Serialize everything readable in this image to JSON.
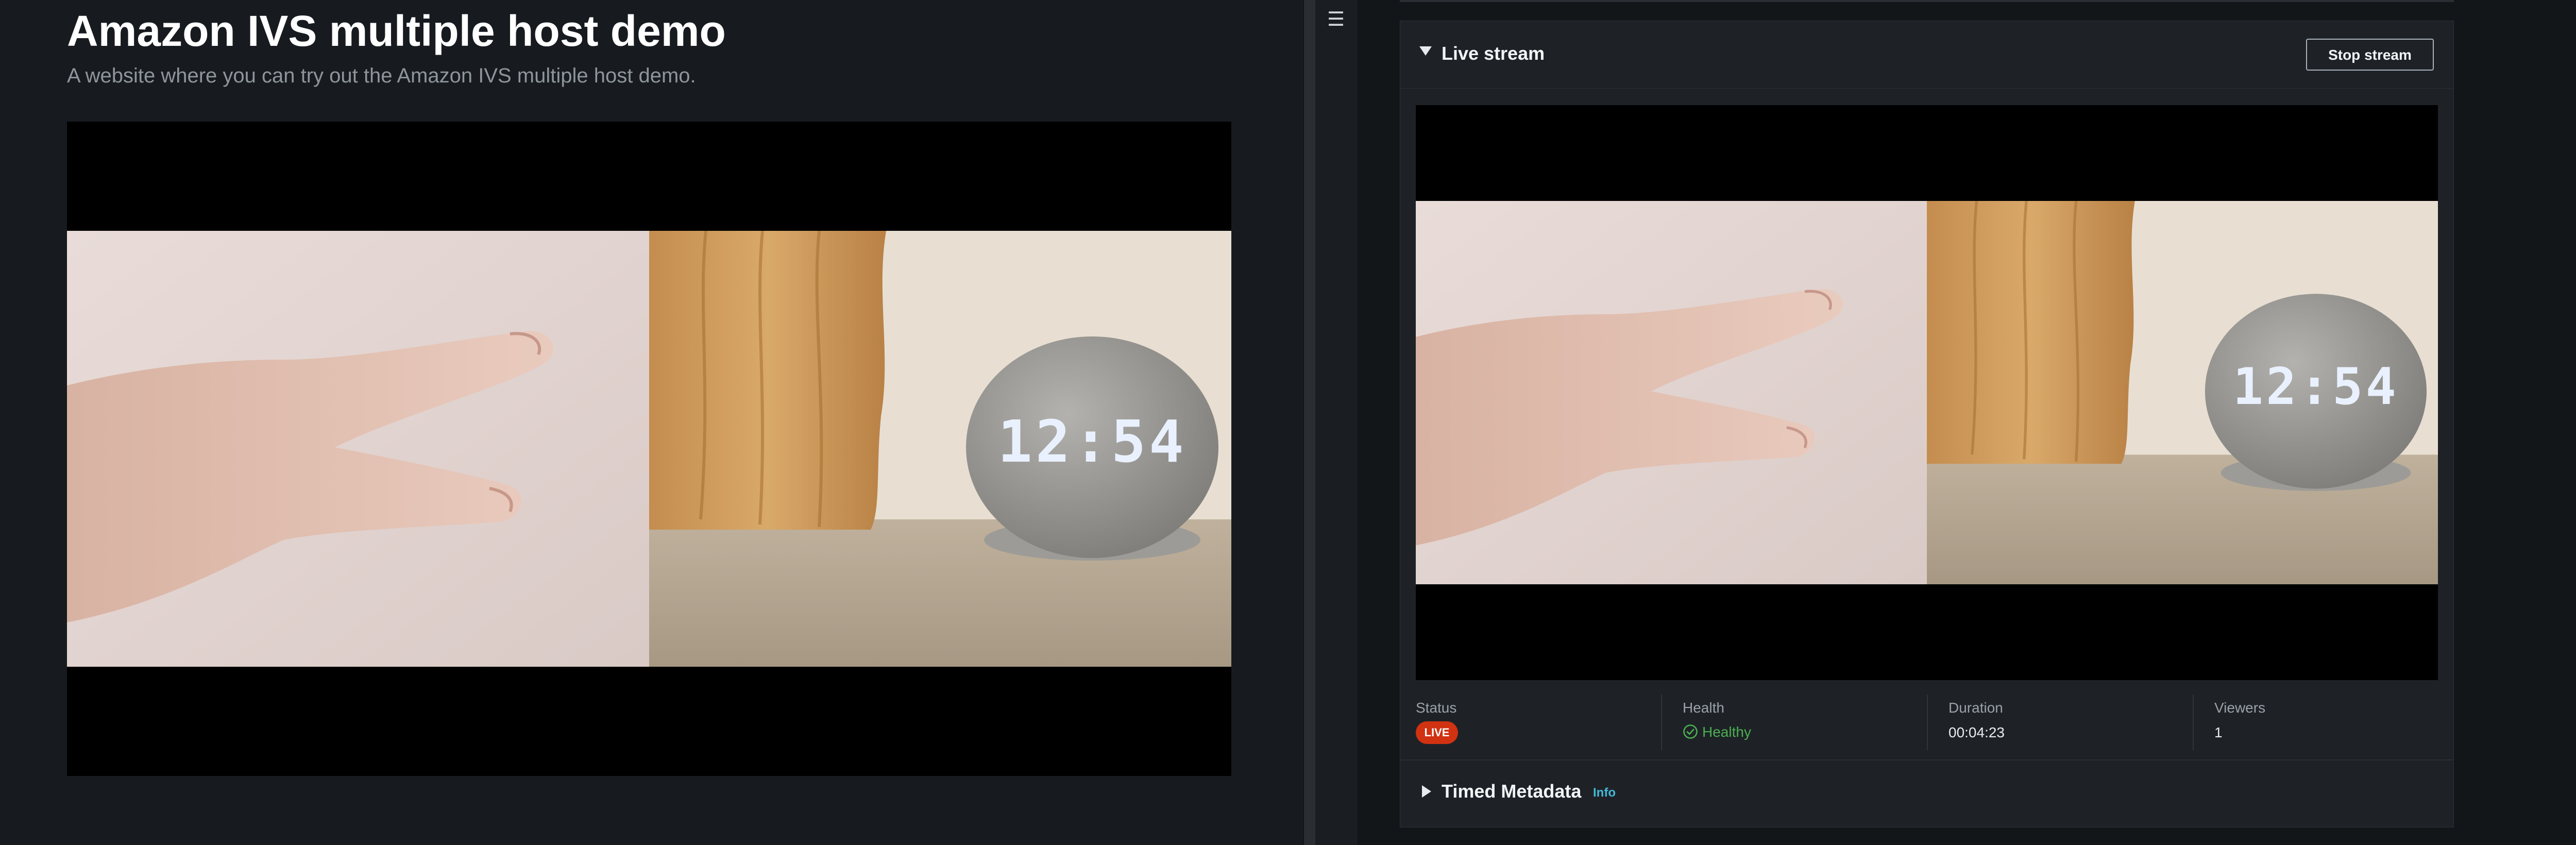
{
  "demo_site": {
    "title": "Amazon IVS multiple host demo",
    "subtitle": "A website where you can try out the Amazon IVS multiple host demo."
  },
  "video_content": {
    "clock_display": "12:54",
    "participants": [
      "hand pointing",
      "wooden stand and smart speaker with clock"
    ]
  },
  "console": {
    "menu_icon": "hamburger-icon",
    "live_stream": {
      "title": "Live stream",
      "stop_button_label": "Stop stream",
      "stats": {
        "status": {
          "label": "Status",
          "badge": "LIVE"
        },
        "health": {
          "label": "Health",
          "value": "Healthy",
          "icon": "check-circle-icon"
        },
        "duration": {
          "label": "Duration",
          "value": "00:04:23"
        },
        "viewers": {
          "label": "Viewers",
          "value": "1"
        }
      }
    },
    "timed_metadata": {
      "title": "Timed Metadata",
      "info_link": "Info"
    }
  },
  "colors": {
    "page_background": "#171b1f",
    "panel_background": "#1e2227",
    "live_badge": "#d13212",
    "healthy": "#4caf50",
    "info_link": "#44b9d6"
  }
}
